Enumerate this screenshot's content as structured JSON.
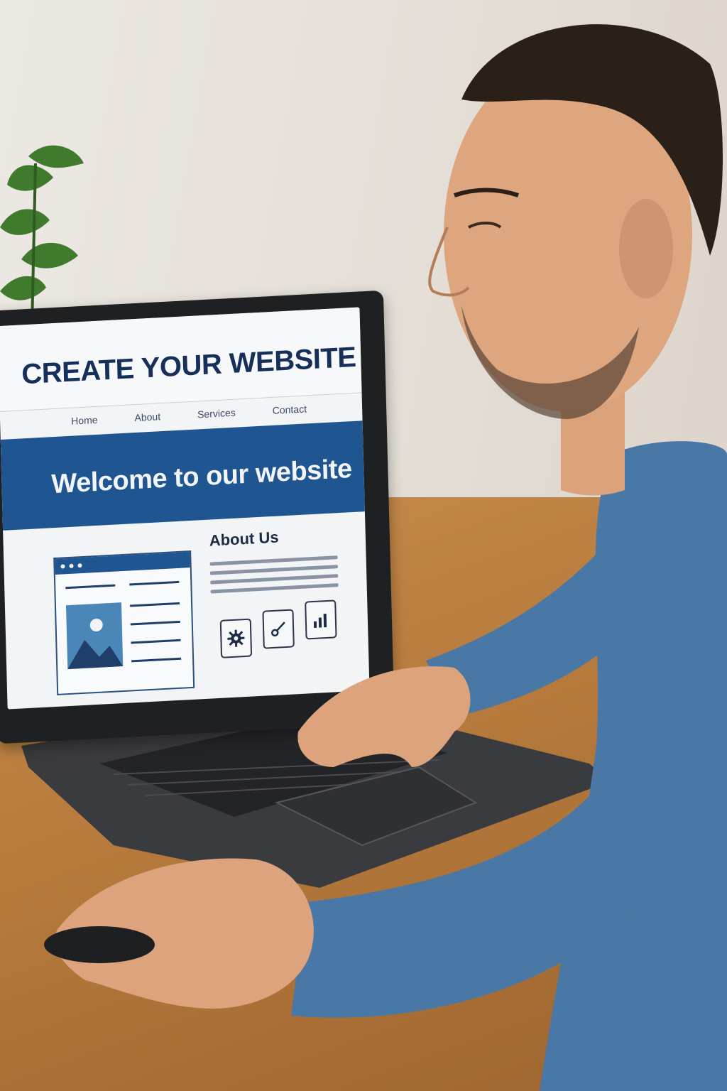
{
  "website": {
    "title": "CREATE YOUR WEBSITE",
    "nav": [
      "Home",
      "About",
      "Services",
      "Contact"
    ],
    "hero_heading": "Welcome to our website",
    "about_heading": "About Us",
    "feature_icons": [
      "gear-icon",
      "key-icon",
      "bar-chart-icon"
    ]
  },
  "colors": {
    "brand_blue": "#1f5590",
    "title_navy": "#17305a",
    "sweater_blue": "#4a78a6",
    "desk_wood": "#b67a3c"
  }
}
